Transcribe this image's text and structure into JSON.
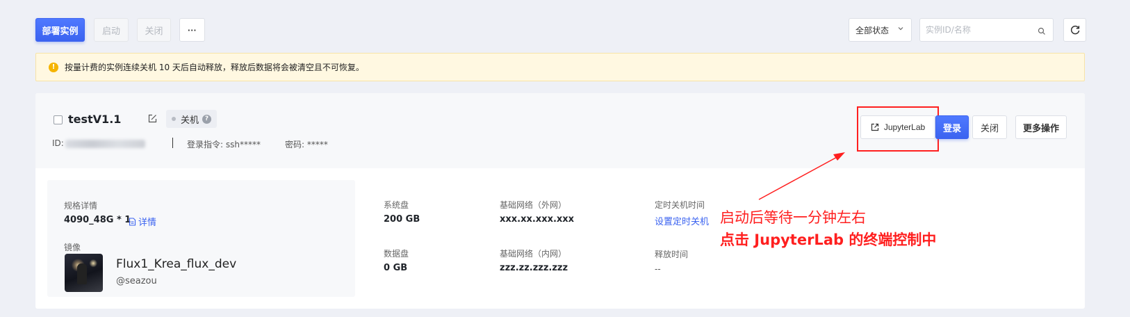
{
  "toolbar": {
    "deploy_label": "部署实例",
    "start_label": "启动",
    "close_label": "关闭",
    "more_label": "···",
    "status_filter": "全部状态",
    "search_placeholder": "实例ID/名称"
  },
  "notice": {
    "text": "按量计费的实例连续关机 10 天后自动释放，释放后数据将会被清空且不可恢复。"
  },
  "instance": {
    "name": "testV1.1",
    "status": "关机",
    "id_label": "ID:",
    "login_cmd": "登录指令: ssh*****",
    "password": "密码: *****",
    "actions": {
      "jupyterlab": "JupyterLab",
      "login": "登录",
      "close": "关闭",
      "more": "更多操作"
    },
    "spec": {
      "label": "规格详情",
      "value": "4090_48G * 1",
      "detail_link": "详情"
    },
    "image": {
      "label": "镜像",
      "name": "Flux1_Krea_flux_dev",
      "author": "@seazou"
    },
    "system_disk": {
      "label": "系统盘",
      "value": "200 GB"
    },
    "data_disk": {
      "label": "数据盘",
      "value": "0 GB"
    },
    "public_network": {
      "label": "基础网络（外网）",
      "value": "xxx.xx.xxx.xxx"
    },
    "private_network": {
      "label": "基础网络（内网）",
      "value": "zzz.zz.zzz.zzz"
    },
    "shutdown_timer": {
      "label": "定时关机时间",
      "link": "设置定时关机"
    },
    "release_time": {
      "label": "释放时间",
      "value": "--"
    }
  },
  "annotation": {
    "line1": "启动后等待一分钟左右",
    "line2": "点击 JupyterLab 的终端控制中",
    "color": "#ff1f1f"
  },
  "colors": {
    "primary": "#3b63f0",
    "warning_bg": "#fff8e1",
    "highlight": "#ff1f1f"
  }
}
